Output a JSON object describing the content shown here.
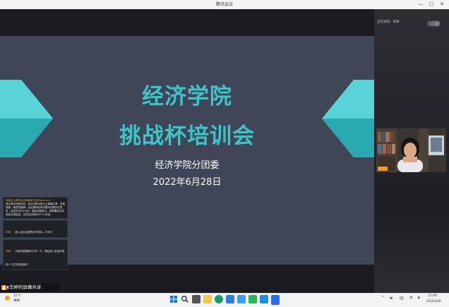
{
  "window": {
    "title": "腾讯会议",
    "minimize": "—",
    "maximize": "□",
    "close": "✕"
  },
  "slide": {
    "title_line1": "经济学院",
    "title_line2": "挑战杯培训会",
    "organizer": "经济学院分团委",
    "date": "2022年6月28日"
  },
  "chat": {
    "messages": [
      {
        "name": "欢迎进入腾讯会议网络研讨会(Webinar)!",
        "text": "请大家关闭麦克风，会议过程中禁止主屏幕共享、录音录像、随意吸烟等。会议期间如有问题可在聊天区发言，会议时长约2小时，建议全程参与，如需要前往其他会议将结束，注意会议秩序与个人安全。"
      },
      {
        "name": "华婷:",
        "text": "进入会议后请把名字改成—下名字"
      },
      {
        "name": "华婷:",
        "text": "大家先把摄像头打开一下，稍后进入会议时请把一下名字改成我们"
      }
    ]
  },
  "share": {
    "text": "华婷的屏幕共享"
  },
  "panel": {
    "speaking": "正在讲话：华婷"
  },
  "taskbar": {
    "weather_temp": "32°C",
    "weather_desc": "晴朗",
    "ime": "中",
    "time": "12:00",
    "date": "2022/6/28"
  },
  "colors": {
    "accent": "#3fc4c9",
    "slide_bg": "#3f4658"
  }
}
